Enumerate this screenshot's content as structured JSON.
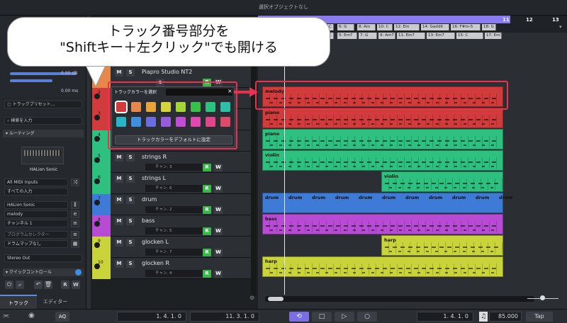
{
  "window": {
    "title": "選択オブジェクトなし"
  },
  "colors": {
    "accent": "#8a7cf0",
    "active_green": "#39b54a"
  },
  "inspector": {
    "volume_value": "0.00 dB",
    "delay_value": "0.00 ms",
    "preset_placeholder": "トラックプリセット...",
    "search_placeholder": "検索を入力",
    "routing_title": "ルーティング",
    "instrument_name": "HALion Sonic",
    "midi_input": "All MIDI Inputs",
    "input_channel": "すべての入力",
    "output_device": "HALion Sonic",
    "output_part": "melody",
    "channel": "チャンネル 1",
    "program_selector": "プログラムセレクター",
    "drum_map": "ドラムマップなし",
    "audio_out": "Stereo Out",
    "quick_controls_title": "クイックコントロール",
    "tab_track": "トラック",
    "tab_editor": "エディター",
    "r_label": "R",
    "w_label": "W"
  },
  "tracks": [
    {
      "num": "1",
      "name": "Piapro Studio NT2",
      "channel": "",
      "color": "#e8874a"
    },
    {
      "num": "2",
      "name": "",
      "channel": "",
      "color": "#d23b3b"
    },
    {
      "num": "3",
      "name": "",
      "channel": "",
      "color": "#d23b3b"
    },
    {
      "num": "4",
      "name": "",
      "channel": "",
      "color": "#2ec07f"
    },
    {
      "num": "5",
      "name": "strings R",
      "channel": "チャン. 3",
      "color": "#2ec07f"
    },
    {
      "num": "6",
      "name": "strings L",
      "channel": "チャン. 6",
      "color": "#2ec07f"
    },
    {
      "num": "7",
      "name": "drum",
      "channel": "チャン. 2",
      "color": "#3d7bd6"
    },
    {
      "num": "8",
      "name": "bass",
      "channel": "チャン. 5",
      "color": "#b84bd4"
    },
    {
      "num": "9",
      "name": "glocken L",
      "channel": "チャン. 7",
      "color": "#c9d33a"
    },
    {
      "num": "10",
      "name": "glocken R",
      "channel": "チャン. 4",
      "color": "#c9d33a"
    }
  ],
  "track_buttons": {
    "mute": "M",
    "solo": "S",
    "read": "R",
    "write": "W",
    "edit": "e"
  },
  "popup": {
    "title": "トラックカラーを選択",
    "close": "×",
    "reset_button": "トラックカラーをデフォルトに設定",
    "swatches": [
      "#d23b3b",
      "#e8874a",
      "#e6a43a",
      "#d6d43a",
      "#a4d43a",
      "#39c04a",
      "#2ec07f",
      "#2ec0a6",
      "#2ab4c8",
      "#3d8fe0",
      "#6c6ce0",
      "#9a5ae0",
      "#c44bd4",
      "#e04ab0",
      "#e0468a",
      "#e04a6a"
    ]
  },
  "callout": {
    "line1": "トラック番号部分を",
    "line2": "\"Shiftキー＋左クリック\"でも開ける"
  },
  "ruler": {
    "marks": [
      "11",
      "12",
      "13"
    ]
  },
  "chords": [
    "C",
    "6: G",
    "8: Am",
    "10: C",
    "12: Em",
    "14: Gadd9",
    "16: F#m-5",
    "18: G",
    "C",
    "5: Em7",
    "7: G",
    "9: Am7",
    "11: Em7",
    "13: Em7",
    "15: C",
    "17: Em7",
    "19: G"
  ],
  "clips": {
    "melody": "melody",
    "piano1": "piano",
    "piano2": "piano",
    "violin1": "violin",
    "violin2": "violin",
    "drum": "drum",
    "bass": "bass",
    "harp1": "harp",
    "harp2": "harp"
  },
  "transport": {
    "left_locator": "1. 4. 1.  0",
    "right_locator": "11. 3. 1.  0",
    "position": "1. 4. 1.  0",
    "tempo": "85.000",
    "tap": "Tap",
    "aq": "AQ"
  }
}
